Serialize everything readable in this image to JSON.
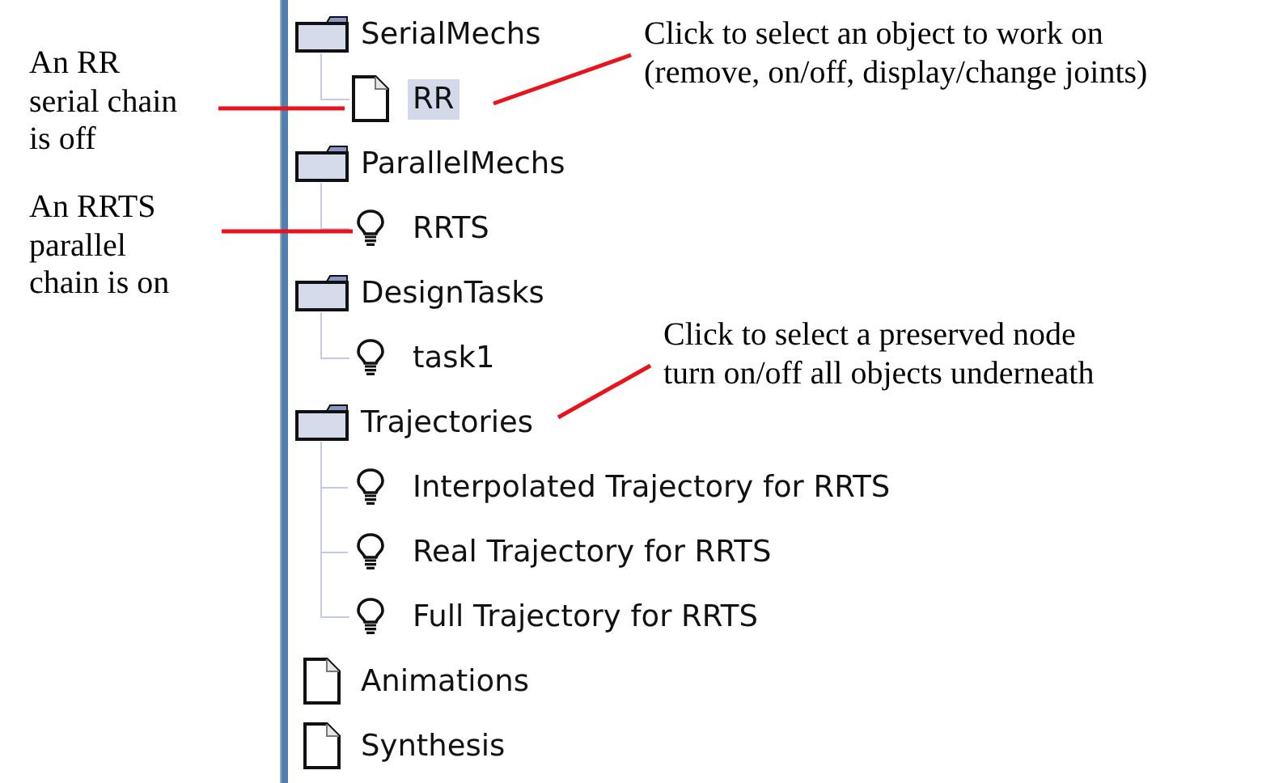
{
  "tree": [
    {
      "label": "SerialMechs",
      "kind": "folder",
      "selected": false,
      "children": [
        {
          "label": "RR",
          "kind": "off",
          "selected": true
        }
      ]
    },
    {
      "label": "ParallelMechs",
      "kind": "folder",
      "selected": false,
      "children": [
        {
          "label": "RRTS",
          "kind": "on",
          "selected": false
        }
      ]
    },
    {
      "label": "DesignTasks",
      "kind": "folder",
      "selected": false,
      "children": [
        {
          "label": "task1",
          "kind": "on",
          "selected": false
        }
      ]
    },
    {
      "label": "Trajectories",
      "kind": "folder",
      "selected": false,
      "children": [
        {
          "label": "Interpolated Trajectory for RRTS",
          "kind": "on",
          "selected": false
        },
        {
          "label": "Real Trajectory for RRTS",
          "kind": "on",
          "selected": false
        },
        {
          "label": "Full Trajectory for RRTS",
          "kind": "on",
          "selected": false
        }
      ]
    },
    {
      "label": "Animations",
      "kind": "off",
      "selected": false
    },
    {
      "label": "Synthesis",
      "kind": "off",
      "selected": false
    }
  ],
  "annotations": [
    {
      "lines": [
        "An RR",
        "serial chain",
        "is off"
      ]
    },
    {
      "lines": [
        "An RRTS",
        "parallel",
        "chain is on"
      ]
    },
    {
      "lines": [
        "Click to select an object to work on",
        "(remove, on/off, display/change joints)"
      ]
    },
    {
      "lines": [
        "Click to select a preserved node",
        "turn on/off all objects underneath"
      ]
    }
  ]
}
